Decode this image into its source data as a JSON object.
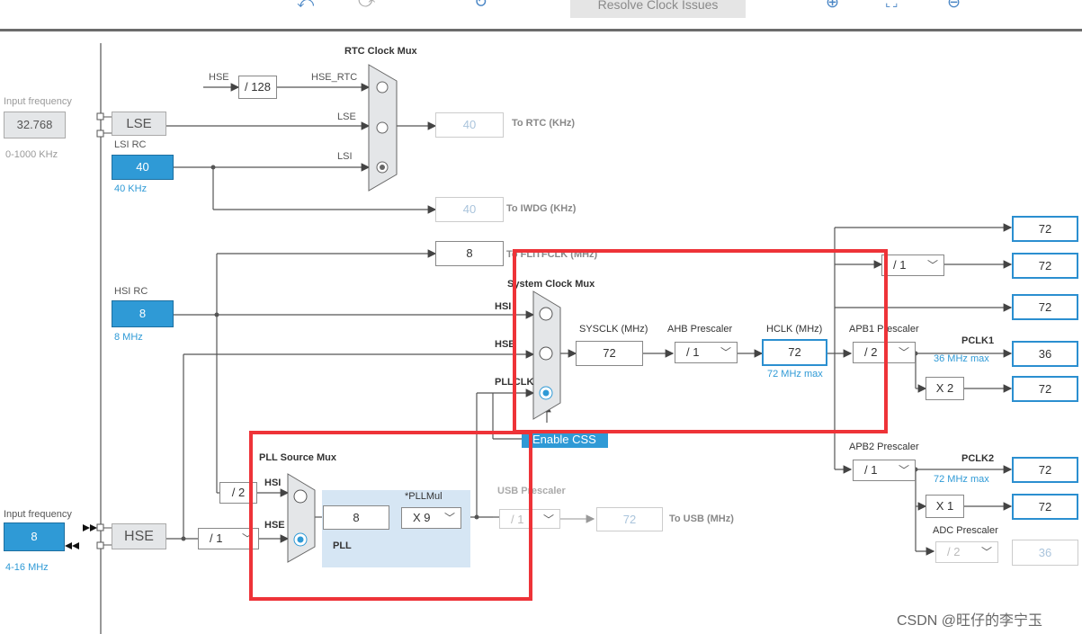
{
  "toolbar": {
    "resolve_label": "Resolve Clock Issues"
  },
  "left": {
    "input_freq_top_label": "Input frequency",
    "lse_value": "32.768",
    "lse_range": "0-1000 KHz",
    "lse_label": "LSE",
    "lsi_label": "LSI RC",
    "lsi_value": "40",
    "lsi_sub": "40 KHz",
    "hsi_label": "HSI RC",
    "hsi_value": "8",
    "hsi_sub": "8 MHz",
    "input_freq_bottom_label": "Input frequency",
    "hse_input_value": "8",
    "hse_range": "4-16 MHz",
    "hse_label": "HSE"
  },
  "rtc": {
    "title": "RTC Clock Mux",
    "hse_label": "HSE",
    "div128": "/ 128",
    "hse_rtc": "HSE_RTC",
    "lse": "LSE",
    "lsi": "LSI",
    "rtc_value": "40",
    "rtc_label": "To RTC (KHz)",
    "iwdg_value": "40",
    "iwdg_label": "To IWDG (KHz)",
    "flit_value": "8",
    "flit_label": "To FLITFCLK (MHz)"
  },
  "sysmux": {
    "title": "System Clock Mux",
    "hsi": "HSI",
    "hse": "HSE",
    "pllclk": "PLLCLK",
    "enable_css": "Enable CSS"
  },
  "main": {
    "sysclk_label": "SYSCLK (MHz)",
    "sysclk_value": "72",
    "ahb_label": "AHB Prescaler",
    "ahb_value": "/ 1",
    "hclk_label": "HCLK (MHz)",
    "hclk_value": "72",
    "hclk_max": "72 MHz max",
    "apb1_label": "APB1 Prescaler",
    "apb1_value": "/ 2",
    "pclk1_label": "PCLK1",
    "pclk1_max": "36 MHz max",
    "x2": "X 2",
    "apb2_label": "APB2 Prescaler",
    "apb2_value": "/ 1",
    "pclk2_label": "PCLK2",
    "pclk2_max": "72 MHz max",
    "x1": "X 1",
    "adc_label": "ADC Prescaler",
    "adc_value": "/ 2",
    "top_div": "/ 1"
  },
  "outputs": [
    "72",
    "72",
    "72",
    "36",
    "72",
    "72",
    "72",
    "36"
  ],
  "pll": {
    "title": "PLL Source Mux",
    "hsi": "HSI",
    "hse": "HSE",
    "div2": "/ 2",
    "hse_div": "/ 1",
    "value": "8",
    "mul_label": "*PLLMul",
    "mul_value": "X 9",
    "pll_label": "PLL"
  },
  "usb": {
    "label": "USB Prescaler",
    "value": "/ 1",
    "out_value": "72",
    "out_label": "To USB (MHz)"
  },
  "watermark": "CSDN @旺仔的李宁玉"
}
